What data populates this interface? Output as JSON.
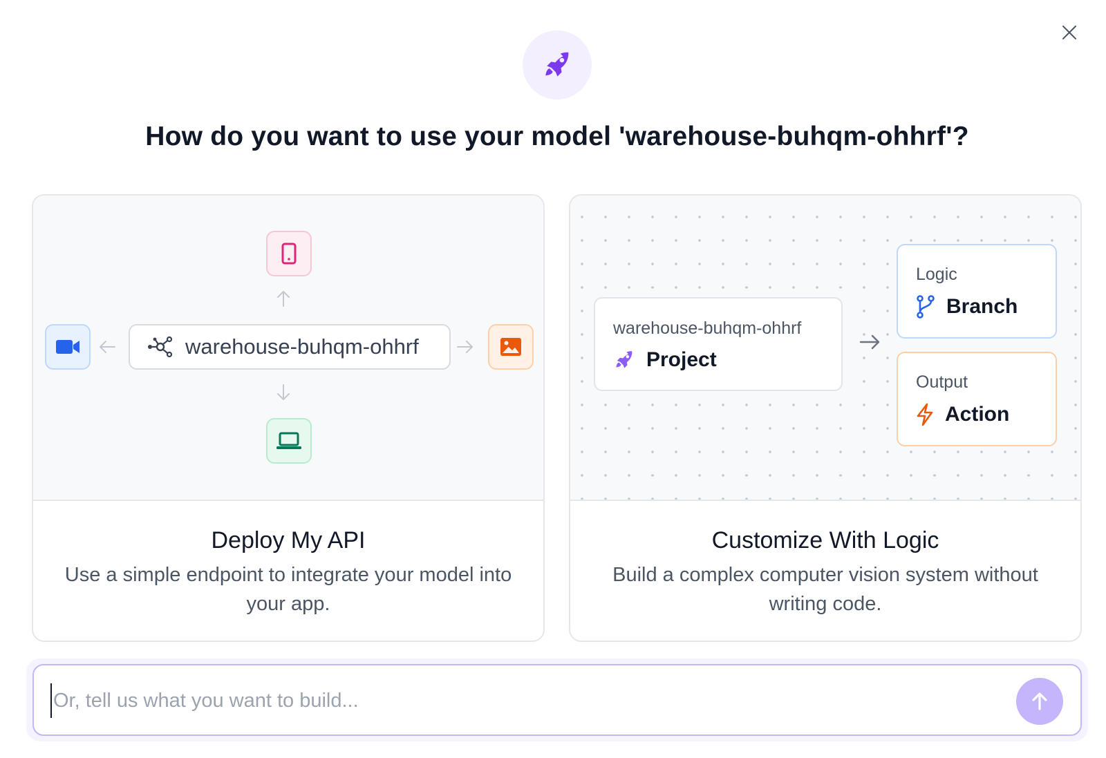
{
  "dialog": {
    "title": "How do you want to use your model 'warehouse-buhqm-ohhrf'?"
  },
  "cards": {
    "deploy": {
      "model_name": "warehouse-buhqm-ohhrf",
      "title": "Deploy My API",
      "description": "Use a simple endpoint to integrate your model into your app."
    },
    "customize": {
      "project_sub": "warehouse-buhqm-ohhrf",
      "project_label": "Project",
      "logic_sub": "Logic",
      "logic_label": "Branch",
      "output_sub": "Output",
      "output_label": "Action",
      "title": "Customize With Logic",
      "description": "Build a complex computer vision system without writing code."
    }
  },
  "prompt": {
    "value": "",
    "placeholder": "Or, tell us what you want to build..."
  },
  "icons": {
    "close": "close-icon",
    "hero": "rocket-icon",
    "phone": "phone-icon",
    "video": "video-camera-icon",
    "image": "image-icon",
    "laptop": "laptop-icon",
    "model": "network-nodes-icon",
    "branch": "git-branch-icon",
    "action": "lightning-bolt-icon",
    "send": "arrow-up-icon"
  },
  "colors": {
    "accent_purple": "#7c3aed",
    "accent_light_purple": "#c4b5fd",
    "pink": "#db2777",
    "blue": "#2563eb",
    "orange": "#ea580c",
    "green": "#059669"
  }
}
